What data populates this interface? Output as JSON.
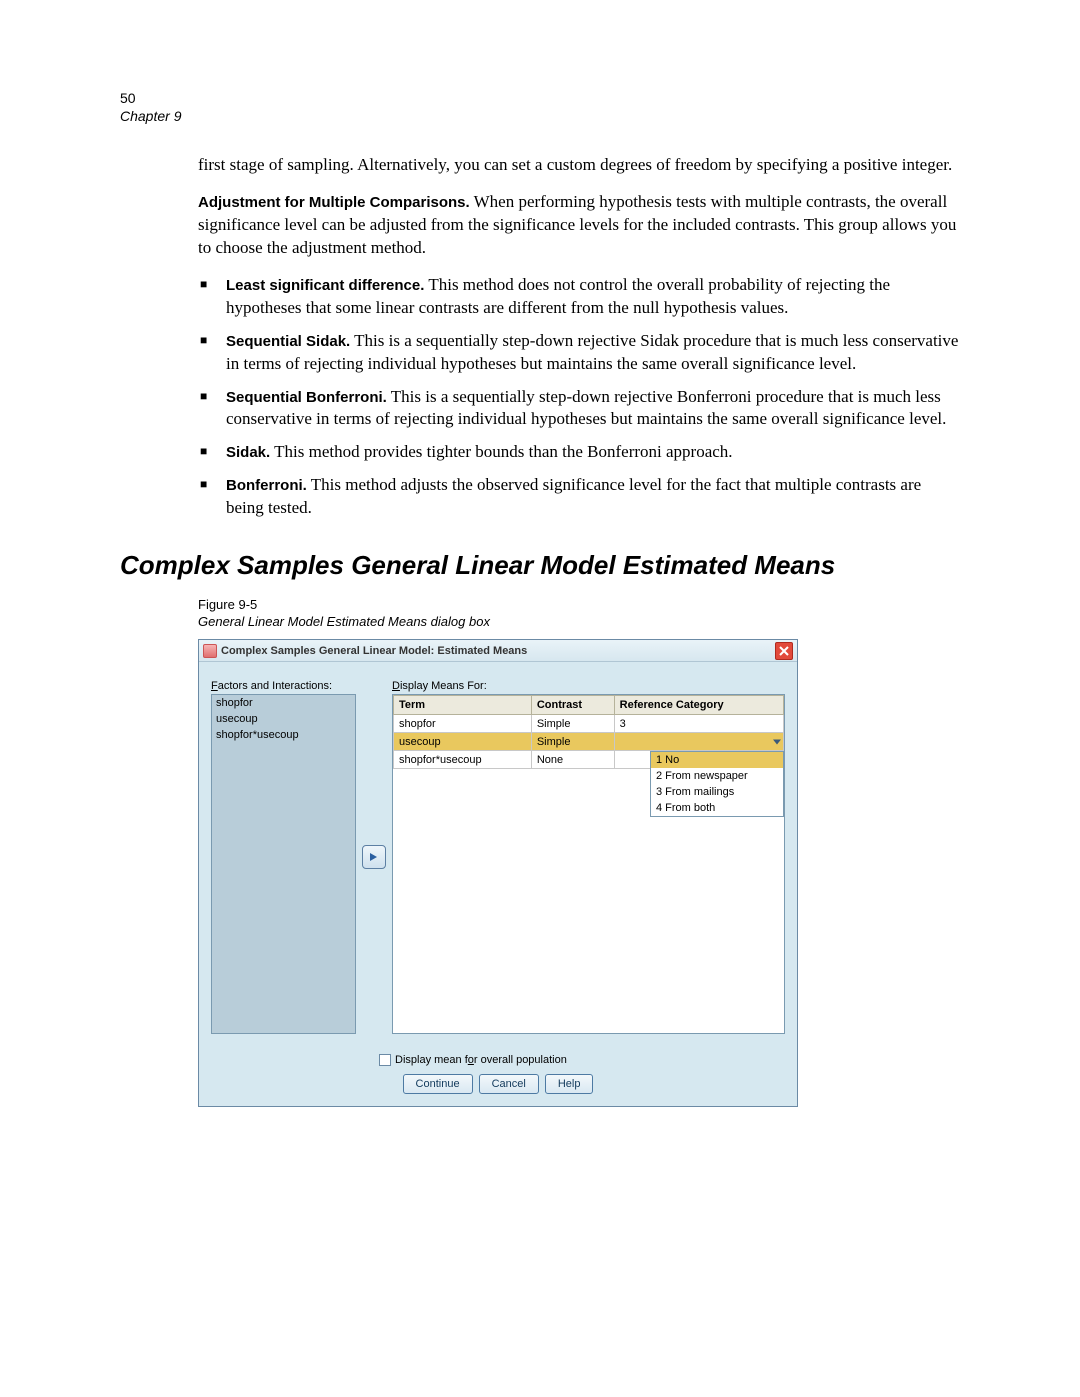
{
  "page": {
    "number": "50",
    "chapter": "Chapter 9"
  },
  "intro_para": "first stage of sampling. Alternatively, you can set a custom degrees of freedom by specifying a positive integer.",
  "adjustment": {
    "lead_bold": "Adjustment for Multiple Comparisons.",
    "lead_rest": " When performing hypothesis tests with multiple contrasts, the overall significance level can be adjusted from the significance levels for the included contrasts. This group allows you to choose the adjustment method."
  },
  "bullets": [
    {
      "bold": "Least significant difference.",
      "rest": " This method does not control the overall probability of rejecting the hypotheses that some linear contrasts are different from the null hypothesis values."
    },
    {
      "bold": "Sequential Sidak.",
      "rest": " This is a sequentially step-down rejective Sidak procedure that is much less conservative in terms of rejecting individual hypotheses but maintains the same overall significance level."
    },
    {
      "bold": "Sequential Bonferroni.",
      "rest": " This is a sequentially step-down rejective Bonferroni procedure that is much less conservative in terms of rejecting individual hypotheses but maintains the same overall significance level."
    },
    {
      "bold": "Sidak.",
      "rest": " This method provides tighter bounds than the Bonferroni approach."
    },
    {
      "bold": "Bonferroni.",
      "rest": " This method adjusts the observed significance level for the fact that multiple contrasts are being tested."
    }
  ],
  "heading": "Complex Samples General Linear Model Estimated Means",
  "figure": {
    "label": "Figure 9-5",
    "caption": "General Linear Model Estimated Means dialog box"
  },
  "dialog": {
    "title": "Complex Samples General Linear Model: Estimated Means",
    "left_label": "Factors and Interactions:",
    "left_items": [
      "shopfor",
      "usecoup",
      "shopfor*usecoup"
    ],
    "right_label": "Display Means For:",
    "table": {
      "headers": [
        "Term",
        "Contrast",
        "Reference Category"
      ],
      "rows": [
        {
          "term": "shopfor",
          "contrast": "Simple",
          "ref": "3",
          "selected": false
        },
        {
          "term": "usecoup",
          "contrast": "Simple",
          "ref": "",
          "selected": true,
          "dropdown": true
        },
        {
          "term": "shopfor*usecoup",
          "contrast": "None",
          "ref": "",
          "selected": false
        }
      ]
    },
    "dropdown_options": [
      {
        "label": "1 No",
        "selected": true
      },
      {
        "label": "2 From newspaper",
        "selected": false
      },
      {
        "label": "3 From mailings",
        "selected": false
      },
      {
        "label": "4 From both",
        "selected": false
      }
    ],
    "checkbox_label": "Display mean for overall population",
    "buttons": {
      "continue": "Continue",
      "cancel": "Cancel",
      "help": "Help"
    }
  }
}
